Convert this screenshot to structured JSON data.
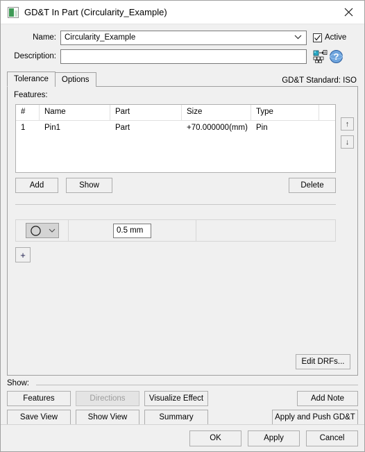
{
  "window": {
    "title": "GD&T In Part (Circularity_Example)",
    "icon": "app-icon",
    "close_label": "✕"
  },
  "header": {
    "name_label": "Name:",
    "name_value": "Circularity_Example",
    "description_label": "Description:",
    "description_value": "",
    "description_placeholder": "",
    "active_label": "Active",
    "active_checked": true,
    "icons": [
      {
        "name": "model-annotation-icon"
      },
      {
        "name": "help-globe-icon"
      }
    ]
  },
  "tabs": {
    "items": [
      {
        "label": "Tolerance",
        "active": true
      },
      {
        "label": "Options",
        "active": false
      }
    ],
    "standard_label": "GD&T Standard: ISO"
  },
  "features": {
    "label": "Features:",
    "columns": [
      "#",
      "Name",
      "Part",
      "Size",
      "Type",
      ""
    ],
    "rows": [
      {
        "num": "1",
        "name": "Pin1",
        "part": "Part",
        "size": "+70.000000(mm)",
        "type": "Pin",
        "tail": ""
      }
    ],
    "move_up_label": "↑",
    "move_down_label": "↓",
    "add_label": "Add",
    "show_label": "Show",
    "delete_label": "Delete"
  },
  "control_frame": {
    "symbol": "circularity-symbol",
    "symbol_dropdown_arrow": "chevron-down-icon",
    "tolerance_value": "0.5 mm",
    "datum_value": "",
    "add_row_label": "+",
    "edit_drfs_label": "Edit DRFs..."
  },
  "show_group": {
    "legend": "Show:",
    "buttons": [
      {
        "label": "Features",
        "enabled": true
      },
      {
        "label": "Directions",
        "enabled": false
      },
      {
        "label": "Visualize Effect",
        "enabled": true
      },
      {
        "label": "Add Note",
        "enabled": true
      },
      {
        "label": "Save View",
        "enabled": true
      },
      {
        "label": "Show View",
        "enabled": true
      },
      {
        "label": "Summary",
        "enabled": true
      },
      {
        "label": "Apply and Push GD&T",
        "enabled": true
      }
    ]
  },
  "footer": {
    "ok_label": "OK",
    "apply_label": "Apply",
    "cancel_label": "Cancel"
  },
  "colors": {
    "dialog_bg": "#f0f0f0",
    "titlebar_bg": "#ffffff",
    "field_bg": "#ffffff",
    "border": "#a0a0a0",
    "text": "#000000",
    "disabled_text": "#9d9d9d",
    "icon_accent": "#3f9a56",
    "help_icon": "#5b8fd4"
  }
}
